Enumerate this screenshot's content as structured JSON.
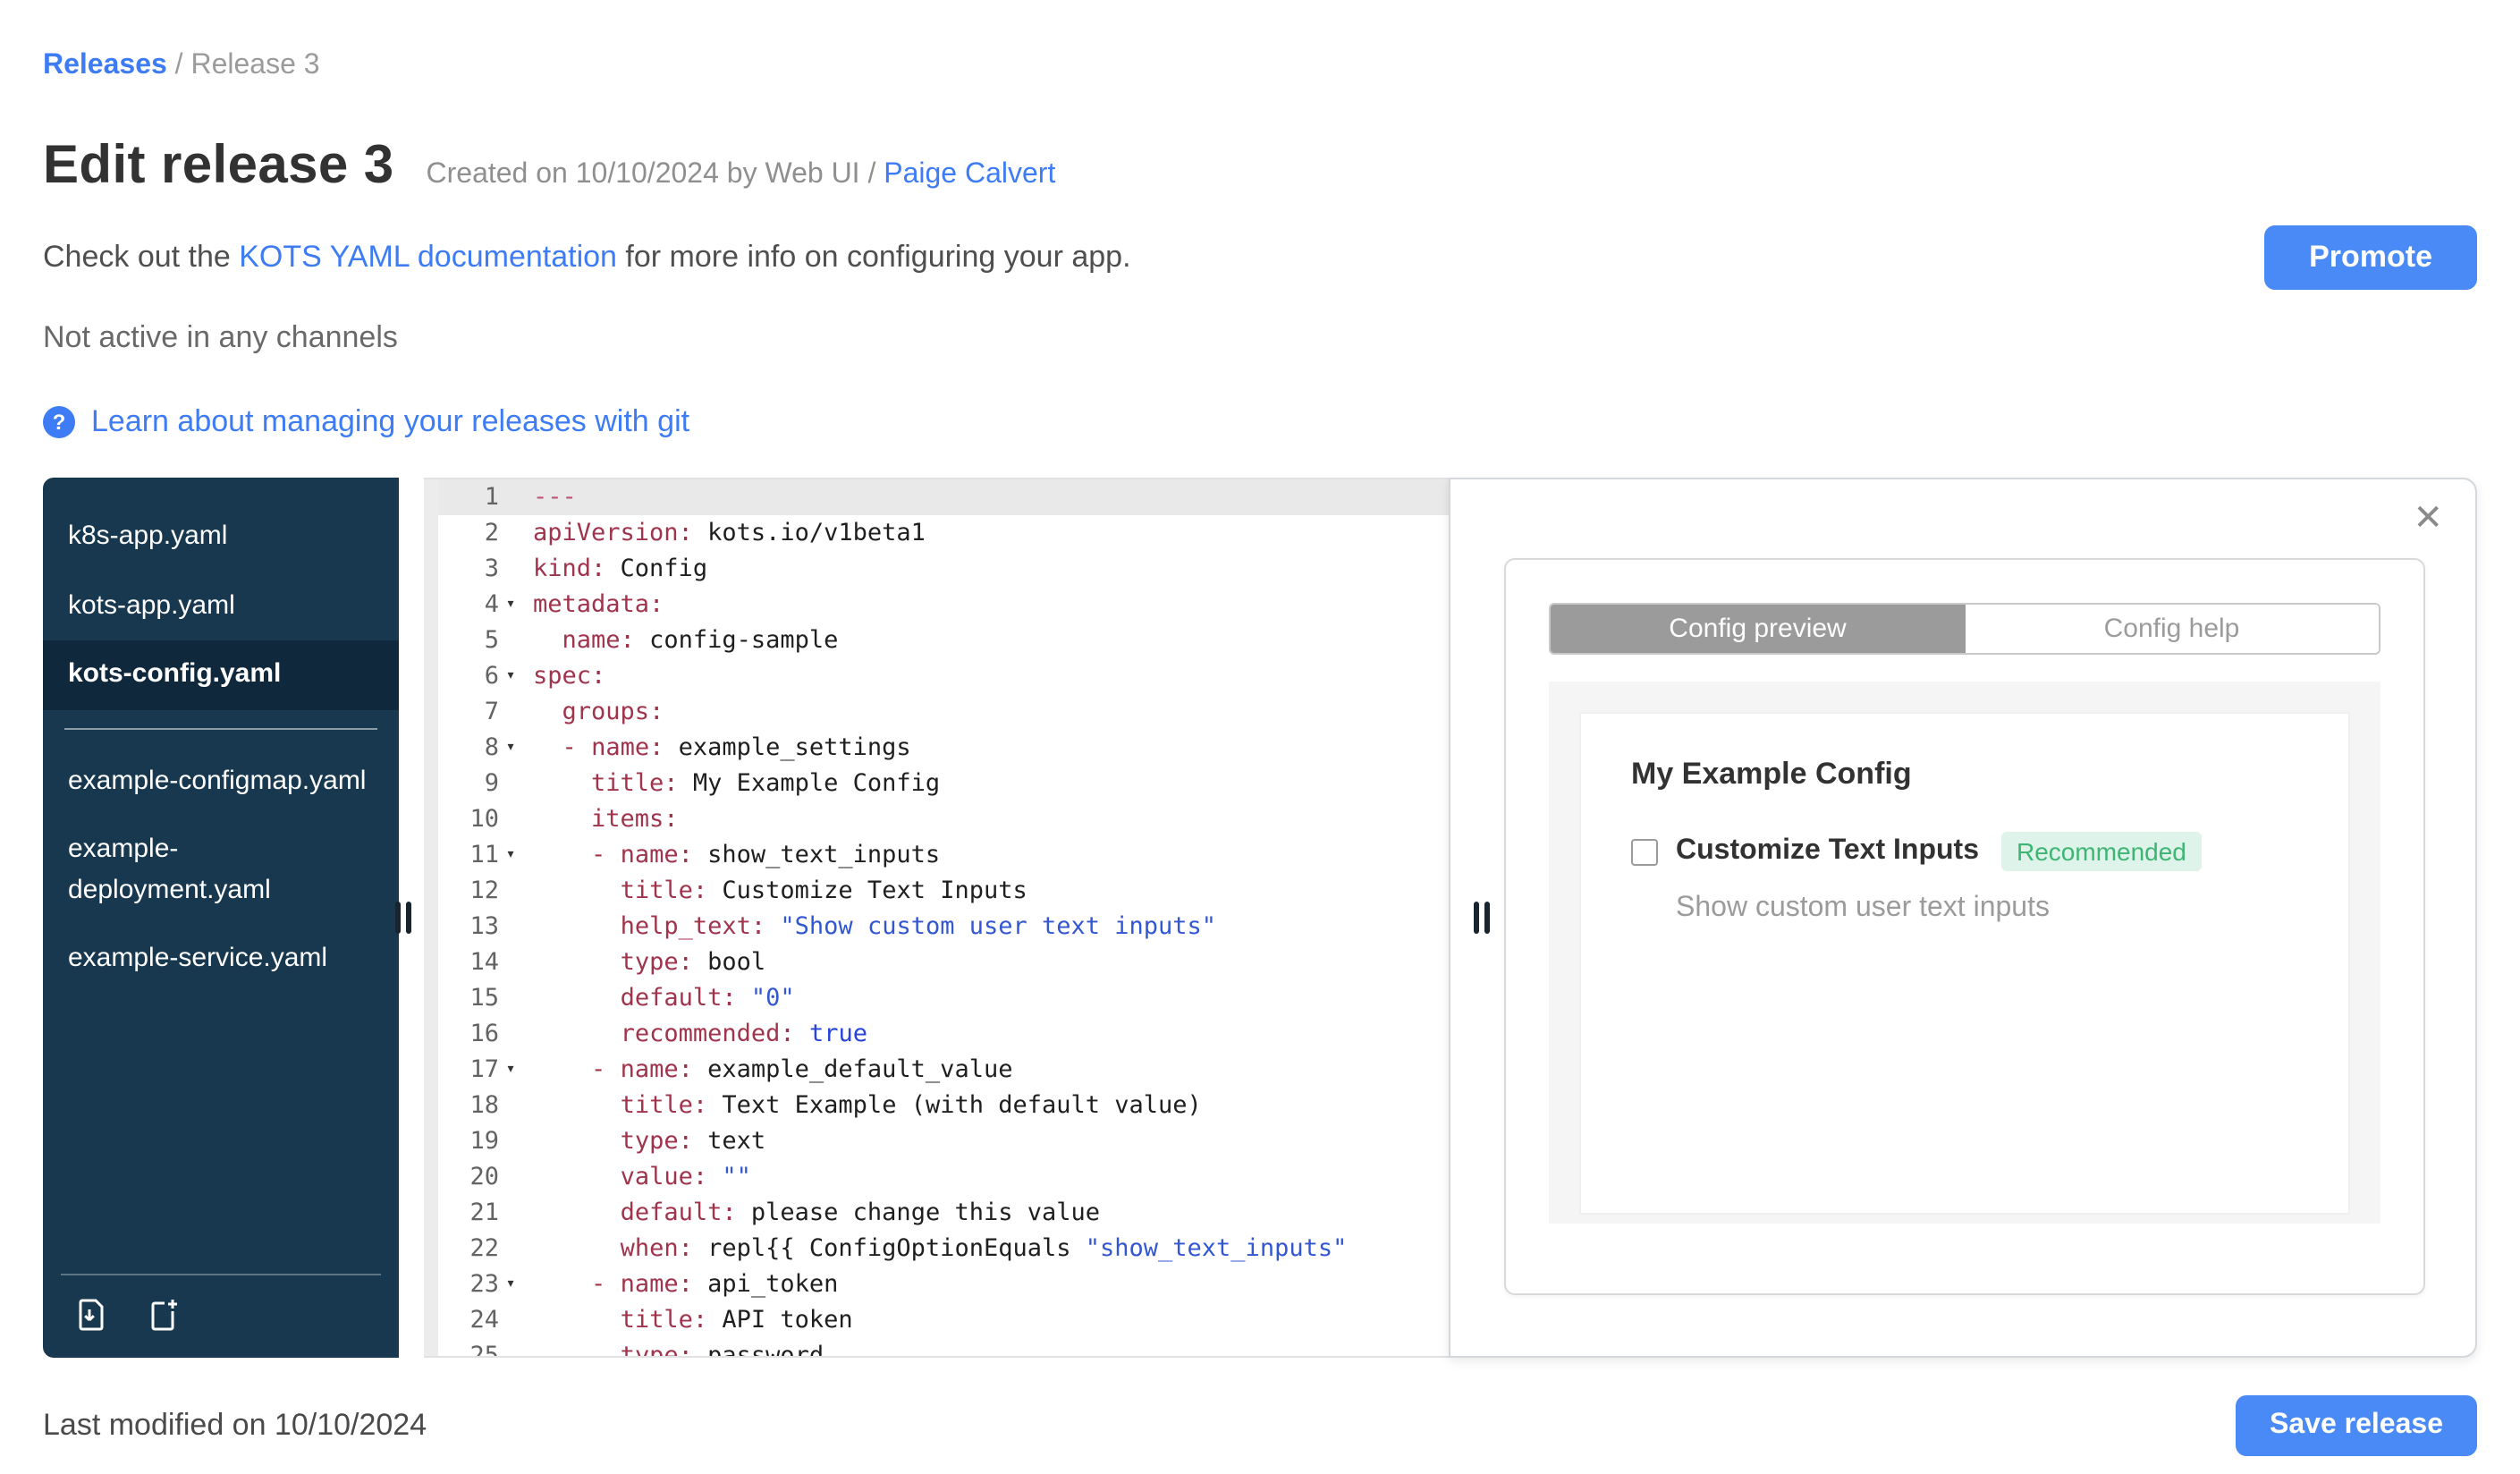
{
  "colors": {
    "accent_blue": "#3d7cf4",
    "button_blue": "#4a8af6",
    "sidebar_navy": "#17384f",
    "badge_green_bg": "#def3e9",
    "badge_green_text": "#3fb573"
  },
  "breadcrumb": {
    "link": "Releases",
    "separator": " / ",
    "current": "Release 3"
  },
  "header": {
    "title": "Edit release 3",
    "created_prefix": "Created on 10/10/2024 by Web UI / ",
    "created_author": "Paige Calvert",
    "doc_prefix": "Check out the ",
    "doc_link": "KOTS YAML documentation",
    "doc_suffix": " for more info on configuring your app.",
    "promote_button": "Promote",
    "channel_status": "Not active in any channels",
    "git_help_icon": "?",
    "git_help_text": "Learn about managing your releases with git"
  },
  "file_tree": {
    "top_files": [
      {
        "name": "k8s-app.yaml",
        "selected": false
      },
      {
        "name": "kots-app.yaml",
        "selected": false
      },
      {
        "name": "kots-config.yaml",
        "selected": true
      }
    ],
    "bottom_files": [
      {
        "name": "example-configmap.yaml",
        "selected": false
      },
      {
        "name": "example-deployment.yaml",
        "selected": false
      },
      {
        "name": "example-service.yaml",
        "selected": false
      }
    ]
  },
  "editor": {
    "active_line": 1,
    "fold_lines": [
      4,
      6,
      8,
      11,
      17,
      23
    ],
    "lines": [
      "---",
      "apiVersion: kots.io/v1beta1",
      "kind: Config",
      "metadata:",
      "  name: config-sample",
      "spec:",
      "  groups:",
      "  - name: example_settings",
      "    title: My Example Config",
      "    items:",
      "    - name: show_text_inputs",
      "      title: Customize Text Inputs",
      "      help_text: \"Show custom user text inputs\"",
      "      type: bool",
      "      default: \"0\"",
      "      recommended: true",
      "    - name: example_default_value",
      "      title: Text Example (with default value)",
      "      type: text",
      "      value: \"\"",
      "      default: please change this value",
      "      when: repl{{ ConfigOptionEquals \"show_text_inputs\"",
      "    - name: api_token",
      "      title: API token",
      "      type: password"
    ]
  },
  "preview": {
    "close_icon": "✕",
    "tab_preview": "Config preview",
    "tab_help": "Config help",
    "group_title": "My Example Config",
    "item_label": "Customize Text Inputs",
    "item_badge": "Recommended",
    "item_help": "Show custom user text inputs",
    "item_checked": false
  },
  "footer": {
    "last_modified": "Last modified on 10/10/2024",
    "save_button": "Save release"
  }
}
